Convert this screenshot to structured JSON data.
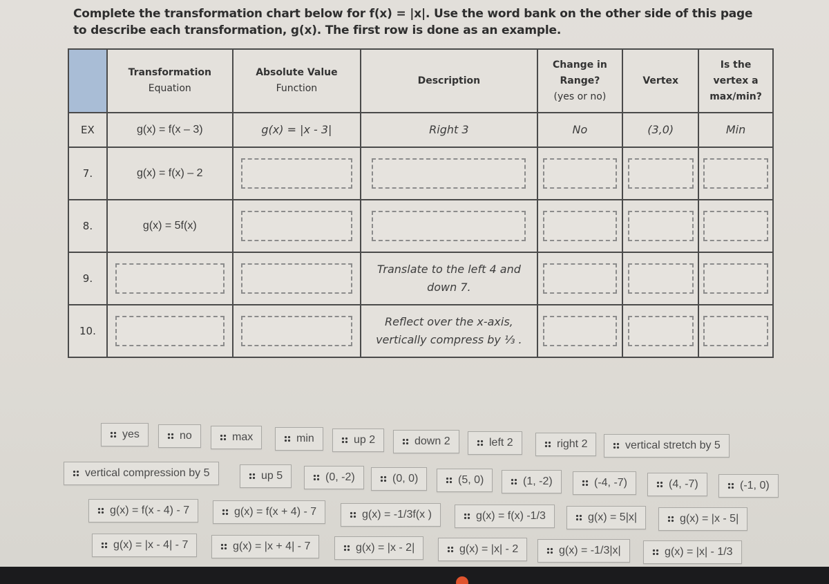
{
  "instructions": {
    "line1": "Complete the transformation chart below for f(x) = |x|. Use the word bank on the other side of this page",
    "line2": "to describe each transformation, g(x). The first row is done as an example."
  },
  "table": {
    "headers": [
      "",
      "Transformation Equation",
      "Absolute Value Function",
      "Description",
      "Change in Range? (yes or no)",
      "Vertex",
      "Is the vertex a max/min?"
    ],
    "header_lines": {
      "transformation": [
        "Transformation",
        "Equation"
      ],
      "absolute": [
        "Absolute Value",
        "Function"
      ],
      "description": [
        "Description"
      ],
      "change": [
        "Change in",
        "Range?",
        "(yes or no)"
      ],
      "vertex": [
        "Vertex"
      ],
      "maxmin": [
        "Is the",
        "vertex a",
        "max/min?"
      ]
    },
    "corner_color": "#a9bdd6",
    "rows": [
      {
        "label": "EX",
        "transformation_equation": "g(x) = f(x – 3)",
        "absolute_value_function": "g(x) = |x - 3|",
        "description": "Right 3",
        "change_in_range": "No",
        "vertex": "(3,0)",
        "max_min": "Min"
      },
      {
        "label": "7.",
        "transformation_equation": "g(x) = f(x) – 2",
        "absolute_value_function": "",
        "description": "",
        "change_in_range": "",
        "vertex": "",
        "max_min": ""
      },
      {
        "label": "8.",
        "transformation_equation": "g(x) = 5f(x)",
        "absolute_value_function": "",
        "description": "",
        "change_in_range": "",
        "vertex": "",
        "max_min": ""
      },
      {
        "label": "9.",
        "transformation_equation": "",
        "absolute_value_function": "",
        "description_lines": [
          "Translate to the left 4 and",
          "down 7."
        ],
        "change_in_range": "",
        "vertex": "",
        "max_min": ""
      },
      {
        "label": "10.",
        "transformation_equation": "",
        "absolute_value_function": "",
        "description_lines": [
          "Reflect over the x-axis,",
          "vertically compress by ⅓ ."
        ],
        "change_in_range": "",
        "vertex": "",
        "max_min": ""
      }
    ]
  },
  "word_bank": {
    "row1": [
      "yes",
      "no",
      "max",
      "min",
      "up 2",
      "down 2",
      "left 2",
      "right 2",
      "vertical stretch by  5"
    ],
    "row2": [
      "vertical compression by 5",
      "up 5",
      "(0, -2)",
      "(0, 0)",
      "(5, 0)",
      "(1, -2)",
      "(-4, -7)",
      "(4, -7)",
      "(-1, 0)"
    ],
    "row3": [
      "g(x) = f(x - 4) - 7",
      "g(x) = f(x + 4) - 7",
      "g(x) = -1/3f(x )",
      "g(x) = f(x) -1/3",
      "g(x) = 5|x|",
      "g(x) = |x - 5|"
    ],
    "row4": [
      "g(x) = |x - 4| - 7",
      "g(x) = |x + 4| - 7",
      "g(x) = |x - 2|",
      "g(x) = |x| - 2",
      "g(x) = -1/3|x|",
      "g(x) = |x| - 1/3"
    ]
  }
}
